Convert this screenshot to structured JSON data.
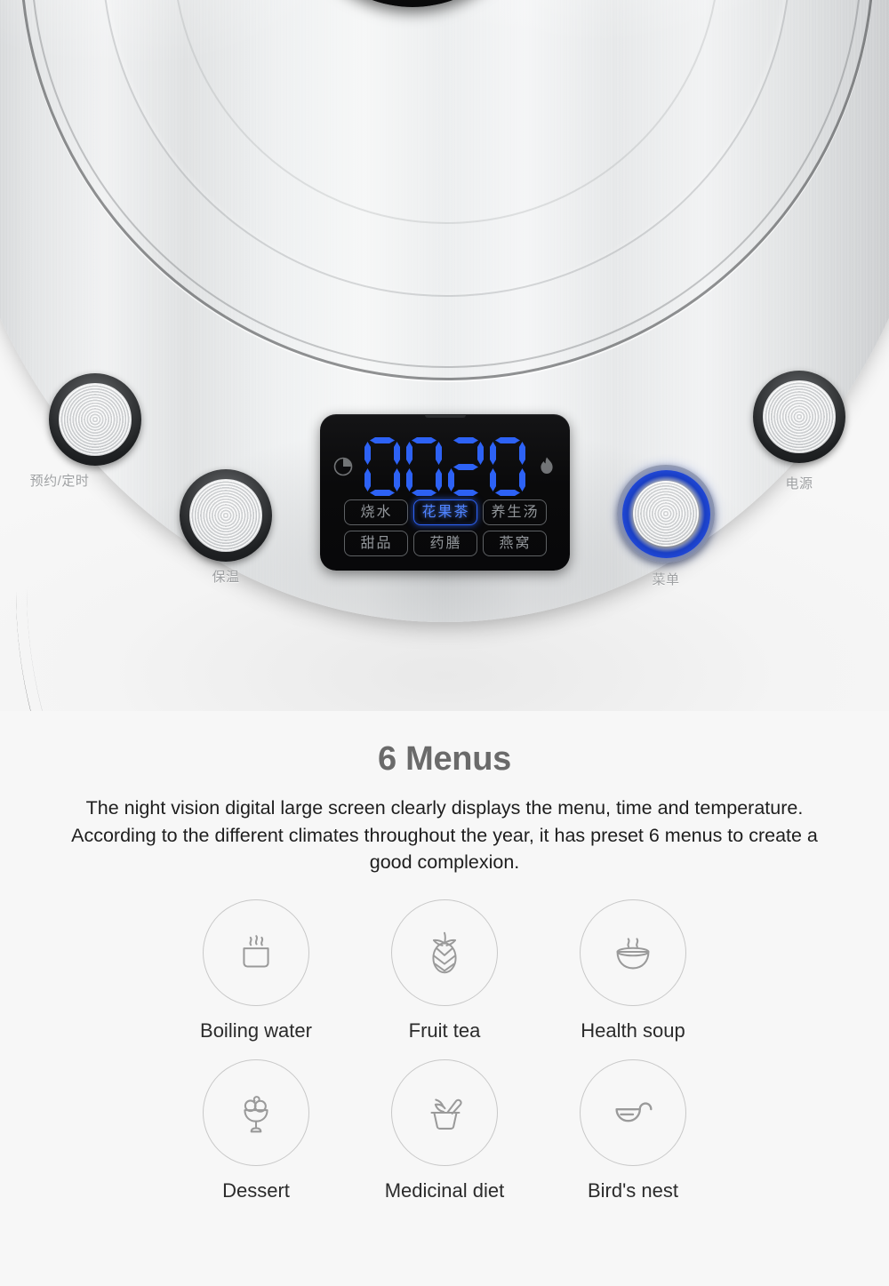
{
  "product": {
    "appliance_type": "electric-kettle-control-panel",
    "buttons": [
      {
        "key": "timer",
        "label": "预约/定时",
        "lit": false
      },
      {
        "key": "keep_warm",
        "label": "保温",
        "lit": false
      },
      {
        "key": "menu",
        "label": "菜单",
        "lit": true
      },
      {
        "key": "power",
        "label": "电源",
        "lit": false
      }
    ],
    "display": {
      "value": "0020",
      "digits": [
        "0",
        "0",
        "2",
        "0"
      ],
      "digit_color": "#2d62f5",
      "left_icon": "clock-icon",
      "right_icon": "flame-icon",
      "menu_rows": [
        [
          {
            "label": "烧水",
            "lit": false
          },
          {
            "label": "花果茶",
            "lit": true
          },
          {
            "label": "养生汤",
            "lit": false
          }
        ],
        [
          {
            "label": "甜品",
            "lit": false
          },
          {
            "label": "药膳",
            "lit": false
          },
          {
            "label": "燕窝",
            "lit": false
          }
        ]
      ]
    }
  },
  "copy": {
    "headline": "6 Menus",
    "body": "The night vision digital large screen clearly displays the menu, time and temperature. According to the different climates throughout the year, it has preset 6 menus to create a good complexion."
  },
  "features": {
    "rows": [
      [
        {
          "icon": "boiling-water-icon",
          "label": "Boiling water"
        },
        {
          "icon": "pineapple-icon",
          "label": "Fruit tea"
        },
        {
          "icon": "soup-bowl-icon",
          "label": "Health soup"
        }
      ],
      [
        {
          "icon": "dessert-cup-icon",
          "label": "Dessert"
        },
        {
          "icon": "mortar-pestle-icon",
          "label": "Medicinal diet"
        },
        {
          "icon": "ladle-icon",
          "label": "Bird's nest"
        }
      ]
    ]
  },
  "colors": {
    "accent_blue": "#2d62f5",
    "headline_gray": "#6a6a6a",
    "body_text": "#1e1e1e",
    "icon_stroke": "#9a9a9a",
    "circle_border": "#c8c8c8",
    "page_background": "#f7f7f7"
  }
}
